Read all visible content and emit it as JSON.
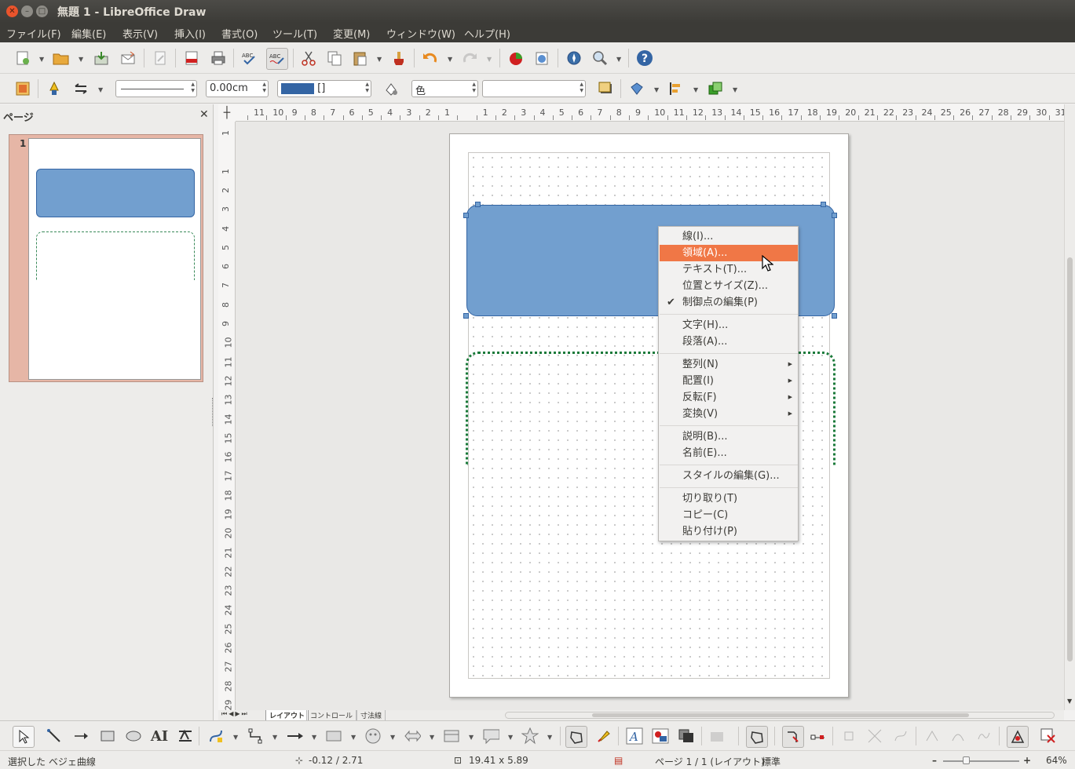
{
  "window": {
    "title": "無題 1 - LibreOffice Draw"
  },
  "menubar": {
    "items": [
      "ファイル(F)",
      "編集(E)",
      "表示(V)",
      "挿入(I)",
      "書式(O)",
      "ツール(T)",
      "変更(M)",
      "ウィンドウ(W)",
      "ヘルプ(H)"
    ]
  },
  "line_toolbar": {
    "line_width": "0.00cm",
    "fill_color_name": "[]",
    "area_style": "色"
  },
  "pages_pane": {
    "title": "ページ",
    "page_number": "1"
  },
  "rulers": {
    "h_labels": [
      "11",
      "10",
      "9",
      "8",
      "7",
      "6",
      "5",
      "4",
      "3",
      "2",
      "1",
      "",
      "1",
      "2",
      "3",
      "4",
      "5",
      "6",
      "7",
      "8",
      "9",
      "10",
      "11",
      "12",
      "13",
      "14",
      "15",
      "16",
      "17",
      "18",
      "19",
      "20",
      "21",
      "22",
      "23",
      "24",
      "25",
      "26",
      "27",
      "28",
      "29",
      "30",
      "31"
    ],
    "v_labels": [
      "1",
      "",
      "1",
      "2",
      "3",
      "4",
      "5",
      "6",
      "7",
      "8",
      "9",
      "10",
      "11",
      "12",
      "13",
      "14",
      "15",
      "16",
      "17",
      "18",
      "19",
      "20",
      "21",
      "22",
      "23",
      "24",
      "25",
      "26",
      "27",
      "28",
      "29"
    ]
  },
  "context_menu": {
    "items": [
      {
        "label": "線(I)...",
        "mnemonic": "I"
      },
      {
        "label": "領域(A)...",
        "highlighted": true
      },
      {
        "label": "テキスト(T)..."
      },
      {
        "label": "位置とサイズ(Z)..."
      },
      {
        "label": "制御点の編集(P)",
        "checked": true
      },
      {
        "label": "文字(H)..."
      },
      {
        "label": "段落(A)..."
      },
      {
        "label": "整列(N)",
        "submenu": true
      },
      {
        "label": "配置(I)",
        "submenu": true
      },
      {
        "label": "反転(F)",
        "submenu": true
      },
      {
        "label": "変換(V)",
        "submenu": true
      },
      {
        "label": "説明(B)..."
      },
      {
        "label": "名前(E)..."
      },
      {
        "label": "スタイルの編集(G)..."
      },
      {
        "label": "切り取り(T)"
      },
      {
        "label": "コピー(C)"
      },
      {
        "label": "貼り付け(P)"
      }
    ]
  },
  "tabs": [
    "レイアウト",
    "コントロール",
    "寸法線"
  ],
  "statusbar": {
    "selection": "選択した ベジェ曲線",
    "position": "-0.12 / 2.71",
    "size": "19.41 x 5.89",
    "page": "ページ 1 / 1 (レイアウト)",
    "style": "標準",
    "zoom": "64%"
  },
  "colors": {
    "shape_fill": "#729fcf",
    "highlight": "#f07746",
    "titlebar": "#3c3b37"
  }
}
